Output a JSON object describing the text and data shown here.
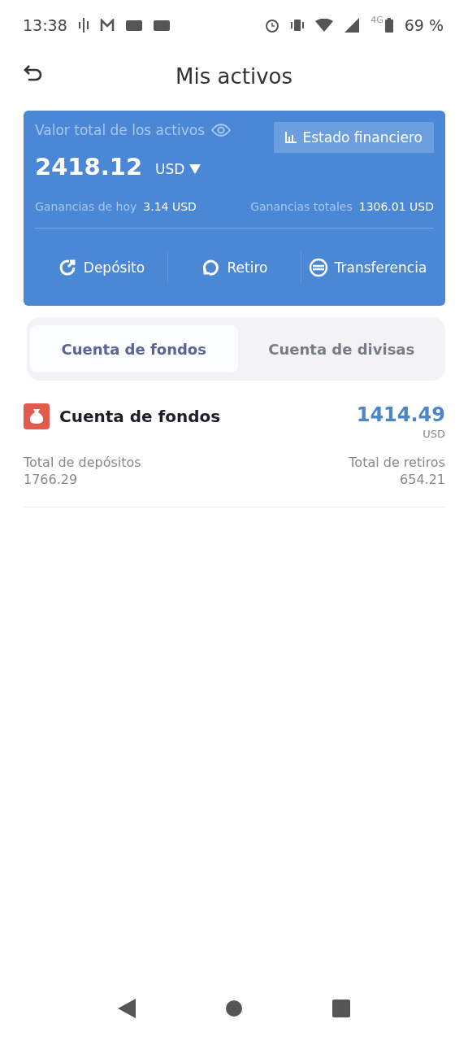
{
  "status_bar": {
    "time": "13:38",
    "network": "4G",
    "battery": "69 %"
  },
  "header": {
    "title": "Mis activos"
  },
  "summary": {
    "label": "Valor total de los activos",
    "report_button": "Estado financiero",
    "total": "2418.12",
    "currency": "USD",
    "today_label": "Ganancias de hoy",
    "today_value": "3.14 USD",
    "overall_label": "Ganancias totales",
    "overall_value": "1306.01 USD",
    "actions": [
      {
        "label": "Depósito"
      },
      {
        "label": "Retiro"
      },
      {
        "label": "Transferencia"
      }
    ]
  },
  "tabs": [
    {
      "label": "Cuenta de fondos",
      "selected": true
    },
    {
      "label": "Cuenta de divisas",
      "selected": false
    }
  ],
  "account": {
    "name": "Cuenta de fondos",
    "balance": "1414.49",
    "currency": "USD",
    "deposits_label": "Total de depósitos",
    "deposits_value": "1766.29",
    "withdrawals_label": "Total de retiros",
    "withdrawals_value": "654.21"
  }
}
